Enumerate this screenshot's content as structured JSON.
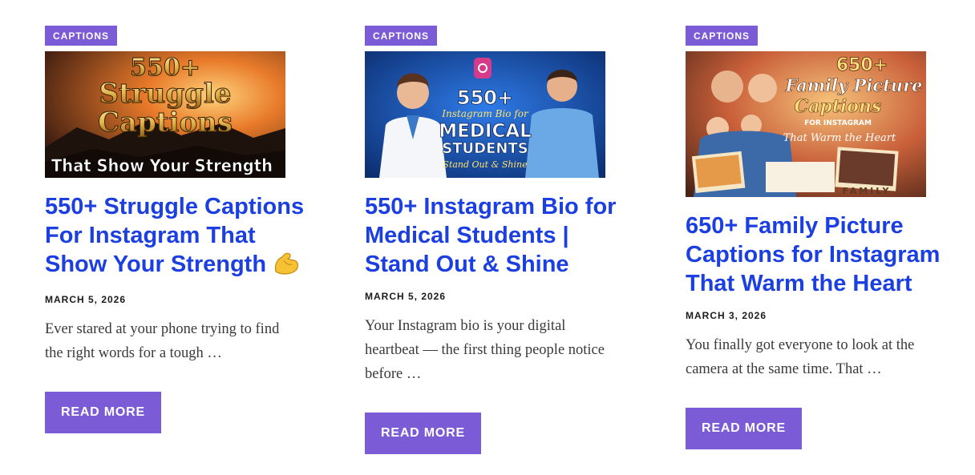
{
  "posts": [
    {
      "category": "CAPTIONS",
      "thumbnail": {
        "line1": "550+",
        "line2": "Struggle",
        "line3": "Captions",
        "line4": "That Show Your Strength"
      },
      "title": "550+ Struggle Captions For Instagram That Show Your Strength",
      "title_emoji": "flexed-biceps-icon",
      "date": "MARCH 5, 2026",
      "excerpt": "Ever stared at your phone trying to find the right words for a tough …",
      "button": "READ MORE"
    },
    {
      "category": "CAPTIONS",
      "thumbnail": {
        "line1": "550+",
        "line2": "Instagram Bio for",
        "line3": "MEDICAL",
        "line4": "STUDENTS",
        "line5": "Stand Out & Shine"
      },
      "title": "550+ Instagram Bio for Medical Students | Stand Out & Shine",
      "date": "MARCH 5, 2026",
      "excerpt": "Your Instagram bio is your digital heartbeat — the first thing people notice before …",
      "button": "READ MORE"
    },
    {
      "category": "CAPTIONS",
      "thumbnail": {
        "line1": "650+",
        "line2": "Family Picture",
        "line3": "Captions",
        "line4": "FOR INSTAGRAM",
        "line5": "That Warm the Heart",
        "line6": "FAMILY"
      },
      "title": "650+ Family Picture Captions for Instagram That Warm the Heart",
      "date": "MARCH 3, 2026",
      "excerpt": "You finally got everyone to look at the camera at the same time. That …",
      "button": "READ MORE"
    }
  ],
  "colors": {
    "accent": "#7b5cd6",
    "title": "#1b3fe0",
    "text": "#3a3a3a"
  }
}
